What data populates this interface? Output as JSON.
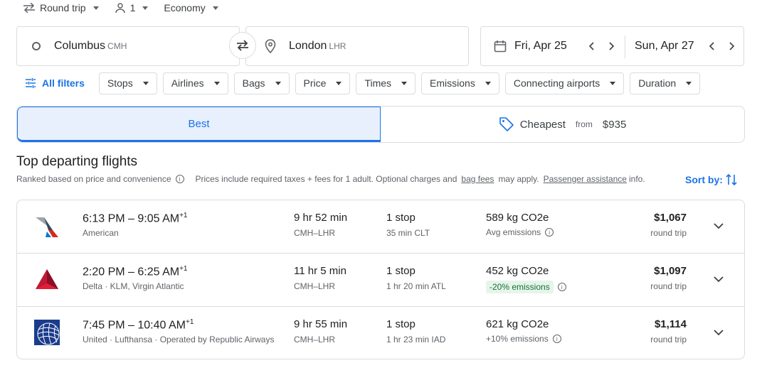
{
  "top_bar": {
    "trip_type": "Round trip",
    "passengers": "1",
    "cabin": "Economy"
  },
  "search": {
    "origin_city": "Columbus",
    "origin_code": "CMH",
    "dest_city": "London",
    "dest_code": "LHR",
    "depart_date": "Fri, Apr 25",
    "return_date": "Sun, Apr 27"
  },
  "filters": {
    "all_filters": "All filters",
    "chips": [
      "Stops",
      "Airlines",
      "Bags",
      "Price",
      "Times",
      "Emissions",
      "Connecting airports",
      "Duration"
    ]
  },
  "tabs": {
    "best": "Best",
    "cheapest": "Cheapest",
    "from": "from",
    "cheapest_price": "$935"
  },
  "results_header": {
    "title": "Top departing flights",
    "ranked": "Ranked based on price and convenience",
    "prices_note_1": "Prices include required taxes + fees for 1 adult. Optional charges and",
    "bag_fees": "bag fees",
    "prices_note_2": "may apply.",
    "passenger_assistance": "Passenger assistance",
    "info": "info.",
    "sort_by": "Sort by:"
  },
  "flights": [
    {
      "times": "6:13 PM – 9:05 AM",
      "plus_day": "+1",
      "airline": "American",
      "duration": "9 hr 52 min",
      "route": "CMH–LHR",
      "stops": "1 stop",
      "layover": "35 min CLT",
      "co2": "589 kg CO2e",
      "emissions": "Avg emissions",
      "price": "$1,067",
      "price_type": "round trip"
    },
    {
      "times": "2:20 PM – 6:25 AM",
      "plus_day": "+1",
      "airline": "Delta · KLM, Virgin Atlantic",
      "duration": "11 hr 5 min",
      "route": "CMH–LHR",
      "stops": "1 stop",
      "layover": "1 hr 20 min ATL",
      "co2": "452 kg CO2e",
      "emissions": "-20% emissions",
      "price": "$1,097",
      "price_type": "round trip"
    },
    {
      "times": "7:45 PM – 10:40 AM",
      "plus_day": "+1",
      "airline": "United · Lufthansa · Operated by Republic Airways",
      "duration": "9 hr 55 min",
      "route": "CMH–LHR",
      "stops": "1 stop",
      "layover": "1 hr 23 min IAD",
      "co2": "621 kg CO2e",
      "emissions": "+10% emissions",
      "price": "$1,114",
      "price_type": "round trip"
    }
  ],
  "colors": {
    "accent": "#1a73e8",
    "border": "#dadce0",
    "best_tab_bg": "#e8f0fe",
    "green_badge_bg": "#e6f4ea",
    "green_badge_text": "#137333"
  },
  "icons": [
    "swap-arrows-icon",
    "person-icon",
    "ring-icon",
    "location-pin-icon",
    "calendar-icon",
    "chevron-left-icon",
    "chevron-right-icon",
    "tune-icon",
    "tag-icon",
    "info-icon",
    "sort-icon",
    "chevron-down-icon"
  ]
}
